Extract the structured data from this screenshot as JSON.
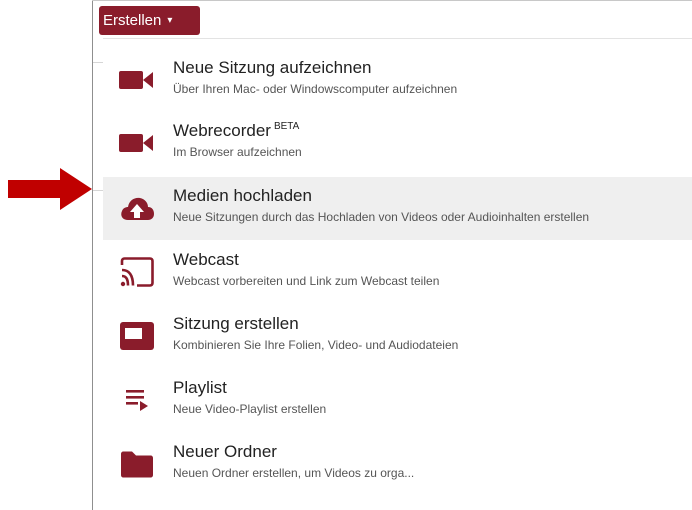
{
  "toolbar": {
    "create_label": "Erstellen",
    "create_caret": "▾"
  },
  "menu": {
    "items": [
      {
        "icon": "video-camera-icon",
        "title": "Neue Sitzung aufzeichnen",
        "badge": "",
        "subtitle": "Über Ihren Mac- oder Windowscomputer aufzeichnen",
        "active": false
      },
      {
        "icon": "video-camera-icon",
        "title": "Webrecorder",
        "badge": "BETA",
        "subtitle": "Im Browser aufzeichnen",
        "active": false
      },
      {
        "icon": "cloud-upload-icon",
        "title": "Medien hochladen",
        "badge": "",
        "subtitle": "Neue Sitzungen durch das Hochladen von Videos oder Audioinhalten erstellen",
        "active": true
      },
      {
        "icon": "cast-icon",
        "title": "Webcast",
        "badge": "",
        "subtitle": "Webcast vorbereiten und Link zum Webcast teilen",
        "active": false
      },
      {
        "icon": "presentation-window-icon",
        "title": "Sitzung erstellen",
        "badge": "",
        "subtitle": "Kombinieren Sie Ihre Folien, Video- und Audiodateien",
        "active": false
      },
      {
        "icon": "playlist-icon",
        "title": "Playlist",
        "badge": "",
        "subtitle": "Neue Video-Playlist erstellen",
        "active": false
      },
      {
        "icon": "folder-icon",
        "title": "Neuer Ordner",
        "badge": "",
        "subtitle": "Neuen Ordner erstellen, um Videos zu orga...",
        "active": false
      }
    ]
  },
  "colors": {
    "accent": "#8a1c2b",
    "pointer_arrow": "#c00000",
    "active_row": "#efefef"
  },
  "annotation": {
    "pointer_icon": "red-arrow-icon"
  }
}
